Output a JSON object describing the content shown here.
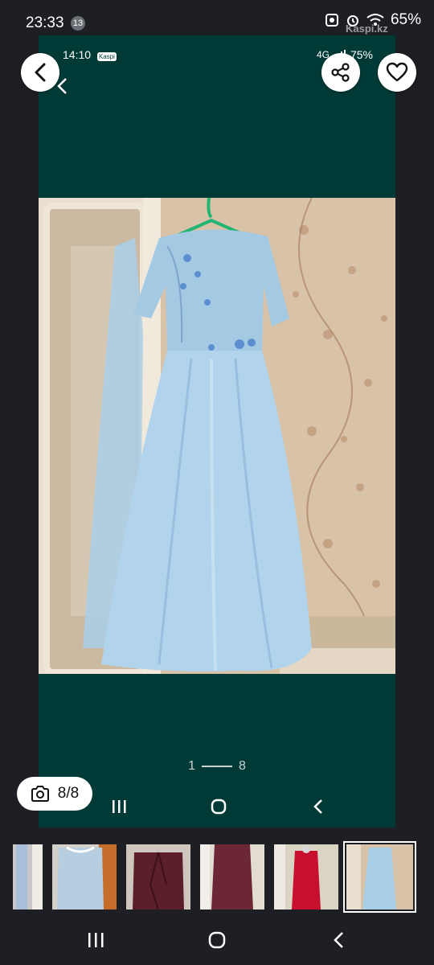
{
  "status_bar": {
    "time": "23:33",
    "notification_count": "13",
    "battery": "65%",
    "icons": [
      "photo-notification-icon",
      "alarm-icon",
      "wifi-icon",
      "battery-icon"
    ]
  },
  "watermark": "Kaspi.kz",
  "viewer": {
    "inner_status_time": "14:10",
    "inner_status_tag": "Kaspi",
    "inner_battery": "75%",
    "inner_network": "4G",
    "pager_current": "1",
    "pager_total": "8",
    "background_color": "#003a37"
  },
  "photo": {
    "subject": "light blue long evening dress on hanger"
  },
  "actions": {
    "back_icon": "chevron-left-icon",
    "share_icon": "share-icon",
    "favorite_icon": "heart-outline-icon"
  },
  "photo_counter": "8/8",
  "thumbnails": [
    {
      "name": "thumb-1-partial",
      "selected": false
    },
    {
      "name": "thumb-2-blue-dress",
      "selected": false
    },
    {
      "name": "thumb-3-burgundy-jacket",
      "selected": false
    },
    {
      "name": "thumb-4-burgundy-coat",
      "selected": false
    },
    {
      "name": "thumb-5-red-dress",
      "selected": false
    },
    {
      "name": "thumb-6-blue-dress-hanger",
      "selected": true
    }
  ],
  "colors": {
    "app_background": "#1d1f24",
    "viewer_background": "#003a37",
    "dress_blue": "#a9cfe8",
    "wallpaper": "#d9c2a6"
  }
}
